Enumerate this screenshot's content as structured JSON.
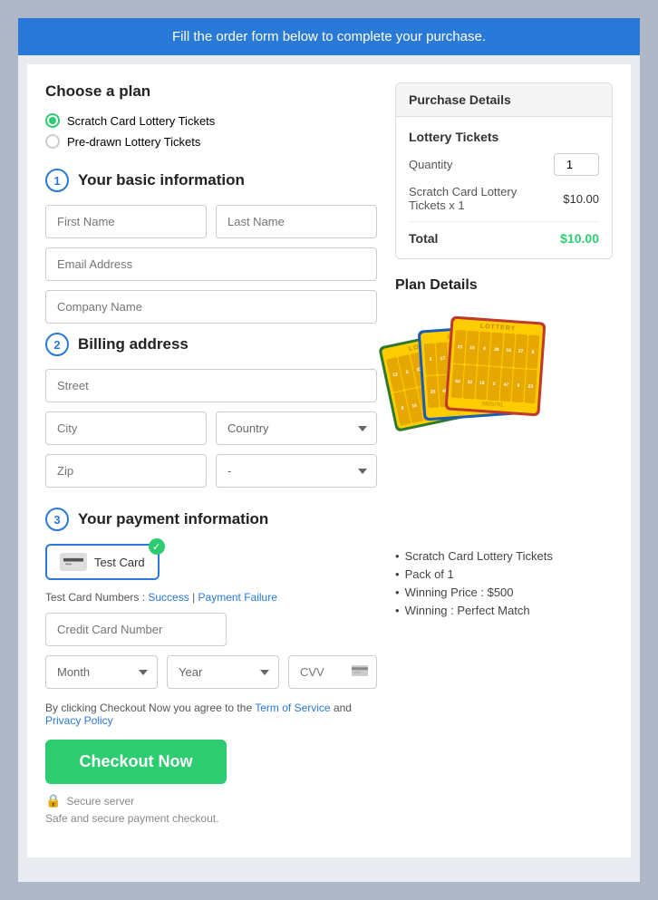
{
  "banner": {
    "text": "Fill the order form below to complete your purchase."
  },
  "plan": {
    "section_title": "Choose a plan",
    "options": [
      {
        "id": "scratch",
        "label": "Scratch Card Lottery Tickets",
        "checked": true
      },
      {
        "id": "predrawn",
        "label": "Pre-drawn Lottery Tickets",
        "checked": false
      }
    ]
  },
  "basic_info": {
    "step": "1",
    "label": "Your basic information",
    "fields": {
      "first_name": "First Name",
      "last_name": "Last Name",
      "email": "Email Address",
      "company": "Company Name"
    }
  },
  "billing": {
    "step": "2",
    "label": "Billing address",
    "fields": {
      "street": "Street",
      "city": "City",
      "country": "Country",
      "zip": "Zip",
      "state": "-"
    }
  },
  "payment": {
    "step": "3",
    "label": "Your payment information",
    "card_label": "Test Card",
    "test_numbers_label": "Test Card Numbers : ",
    "success_label": "Success",
    "separator": " | ",
    "failure_label": "Payment Failure",
    "cc_placeholder": "Credit Card Number",
    "month_label": "Month",
    "year_label": "Year",
    "cvv_label": "CVV",
    "terms_text": "By clicking Checkout Now you agree to the ",
    "terms_link": "Term of Service",
    "terms_and": " and ",
    "privacy_link": "Privacy Policy",
    "checkout_label": "Checkout Now",
    "secure_label": "Secure server",
    "secure_sub": "Safe and secure payment checkout."
  },
  "purchase_details": {
    "header": "Purchase Details",
    "tickets_title": "Lottery Tickets",
    "quantity_label": "Quantity",
    "quantity_value": "1",
    "item_label": "Scratch Card Lottery\nTickets x 1",
    "item_price": "$10.00",
    "total_label": "Total",
    "total_price": "$10.00"
  },
  "plan_details": {
    "title": "Plan Details",
    "bullets": [
      "Scratch Card Lottery Tickets",
      "Pack of 1",
      "Winning Price : $500",
      "Winning : Perfect Match"
    ]
  }
}
